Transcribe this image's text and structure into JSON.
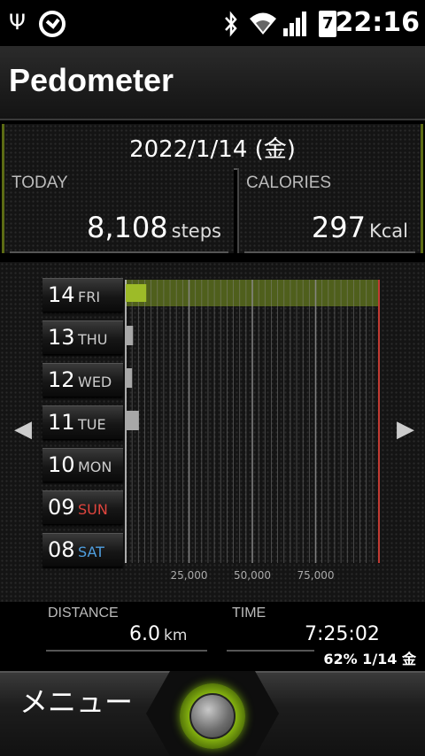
{
  "status_bar": {
    "icons": [
      "usb-icon",
      "sync-circle-icon",
      "bluetooth-icon",
      "wifi-icon",
      "signal-icon",
      "battery-icon"
    ],
    "battery_level": "7",
    "time": "22:16"
  },
  "app": {
    "title": "Pedometer"
  },
  "date": "2022/1/14 (金)",
  "today": {
    "label": "TODAY",
    "value": "8,108",
    "unit": "steps"
  },
  "calories": {
    "label": "CALORIES",
    "value": "297",
    "unit": "Kcal"
  },
  "chart_data": {
    "type": "bar",
    "orientation": "horizontal",
    "categories": [
      {
        "num": "14",
        "dow": "FRI",
        "dow_color": "#cccccc"
      },
      {
        "num": "13",
        "dow": "THU",
        "dow_color": "#cccccc"
      },
      {
        "num": "12",
        "dow": "WED",
        "dow_color": "#cccccc"
      },
      {
        "num": "11",
        "dow": "TUE",
        "dow_color": "#cccccc"
      },
      {
        "num": "10",
        "dow": "MON",
        "dow_color": "#cccccc"
      },
      {
        "num": "09",
        "dow": "SUN",
        "dow_color": "#e0453e"
      },
      {
        "num": "08",
        "dow": "SAT",
        "dow_color": "#4f9fe0"
      }
    ],
    "values": [
      8108,
      2900,
      2500,
      5200,
      0,
      0,
      0
    ],
    "xlim": [
      0,
      100000
    ],
    "x_ticks": [
      "25,000",
      "50,000",
      "75,000"
    ],
    "x_tick_values": [
      25000,
      50000,
      75000
    ],
    "goal": 100000,
    "colors": {
      "today_bar": "#9dbb28",
      "today_row": "#4f5f1c",
      "other_bar": "#a8a8a8",
      "grid": "#8a8a8a",
      "goal_line": "#c23b33"
    }
  },
  "distance": {
    "label": "DISTANCE",
    "value": "6.0",
    "unit": "km"
  },
  "time": {
    "label": "TIME",
    "value": "7:25:02"
  },
  "battery_badge": "62%  1/14 金",
  "bottom_bar": {
    "menu_label": "メニュー"
  }
}
